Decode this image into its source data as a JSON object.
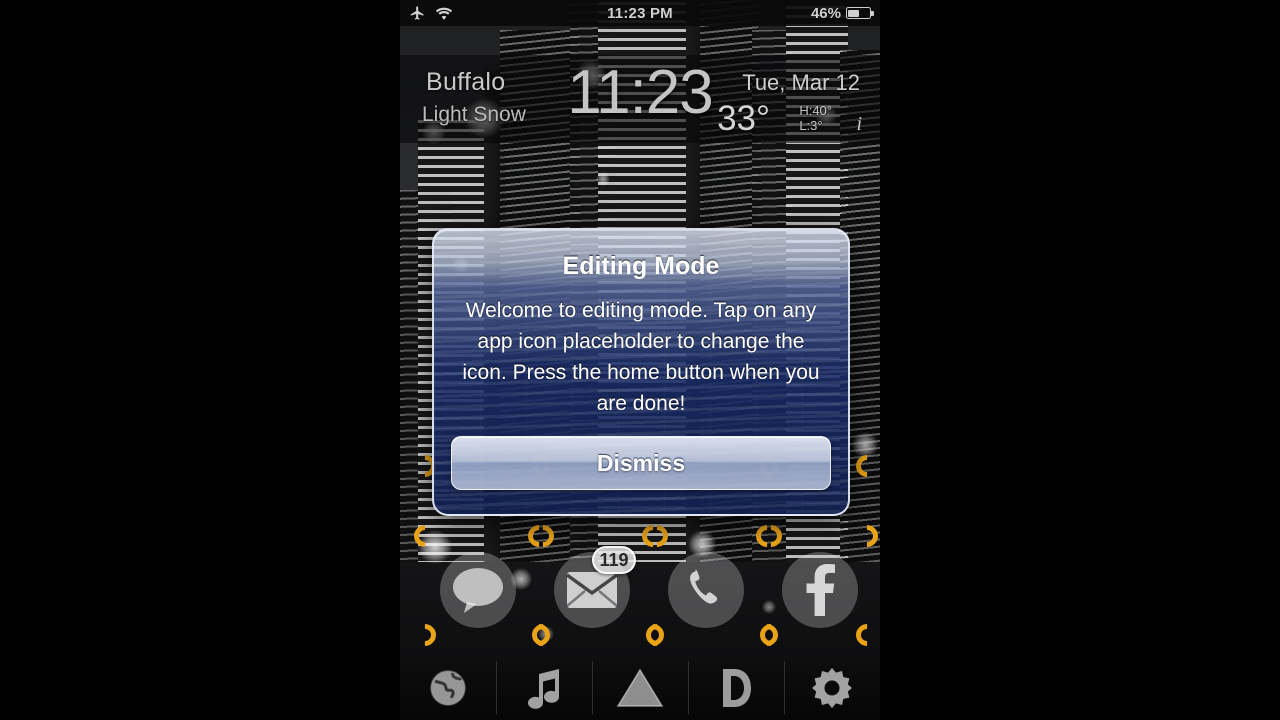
{
  "statusbar": {
    "airplane_icon": "airplane-icon",
    "wifi_icon": "wifi-icon",
    "time": "11:23 PM",
    "battery_percent": "46%",
    "battery_level": 46
  },
  "weather_widget": {
    "city": "Buffalo",
    "condition": "Light Snow",
    "clock": "11:23",
    "date": "Tue, Mar 12",
    "temperature": "33°",
    "high": "H:40°",
    "low": "L:3°",
    "info_label": "i"
  },
  "dialog": {
    "title": "Editing Mode",
    "message": "Welcome to editing mode. Tap on any app icon placeholder to change the icon. Press the home button when you are done!",
    "button_label": "Dismiss"
  },
  "app_icons": [
    {
      "name": "messages",
      "glyph": "speech-bubble-icon",
      "badge": null
    },
    {
      "name": "mail",
      "glyph": "envelope-icon",
      "badge": "119"
    },
    {
      "name": "phone",
      "glyph": "phone-handset-icon",
      "badge": null
    },
    {
      "name": "facebook",
      "glyph": "facebook-f-icon",
      "badge": null
    }
  ],
  "dock": [
    {
      "name": "browser",
      "glyph": "globe-icon"
    },
    {
      "name": "music",
      "glyph": "music-note-icon"
    },
    {
      "name": "triangle-app",
      "glyph": "triangle-icon"
    },
    {
      "name": "dropbox",
      "glyph": "letter-d-icon"
    },
    {
      "name": "settings",
      "glyph": "gear-icon"
    }
  ],
  "colors": {
    "placeholder_bracket": "#e8a317",
    "dialog_top": "#c4d0e8",
    "dialog_body": "#182a64",
    "status_text": "#cfcfcf"
  }
}
